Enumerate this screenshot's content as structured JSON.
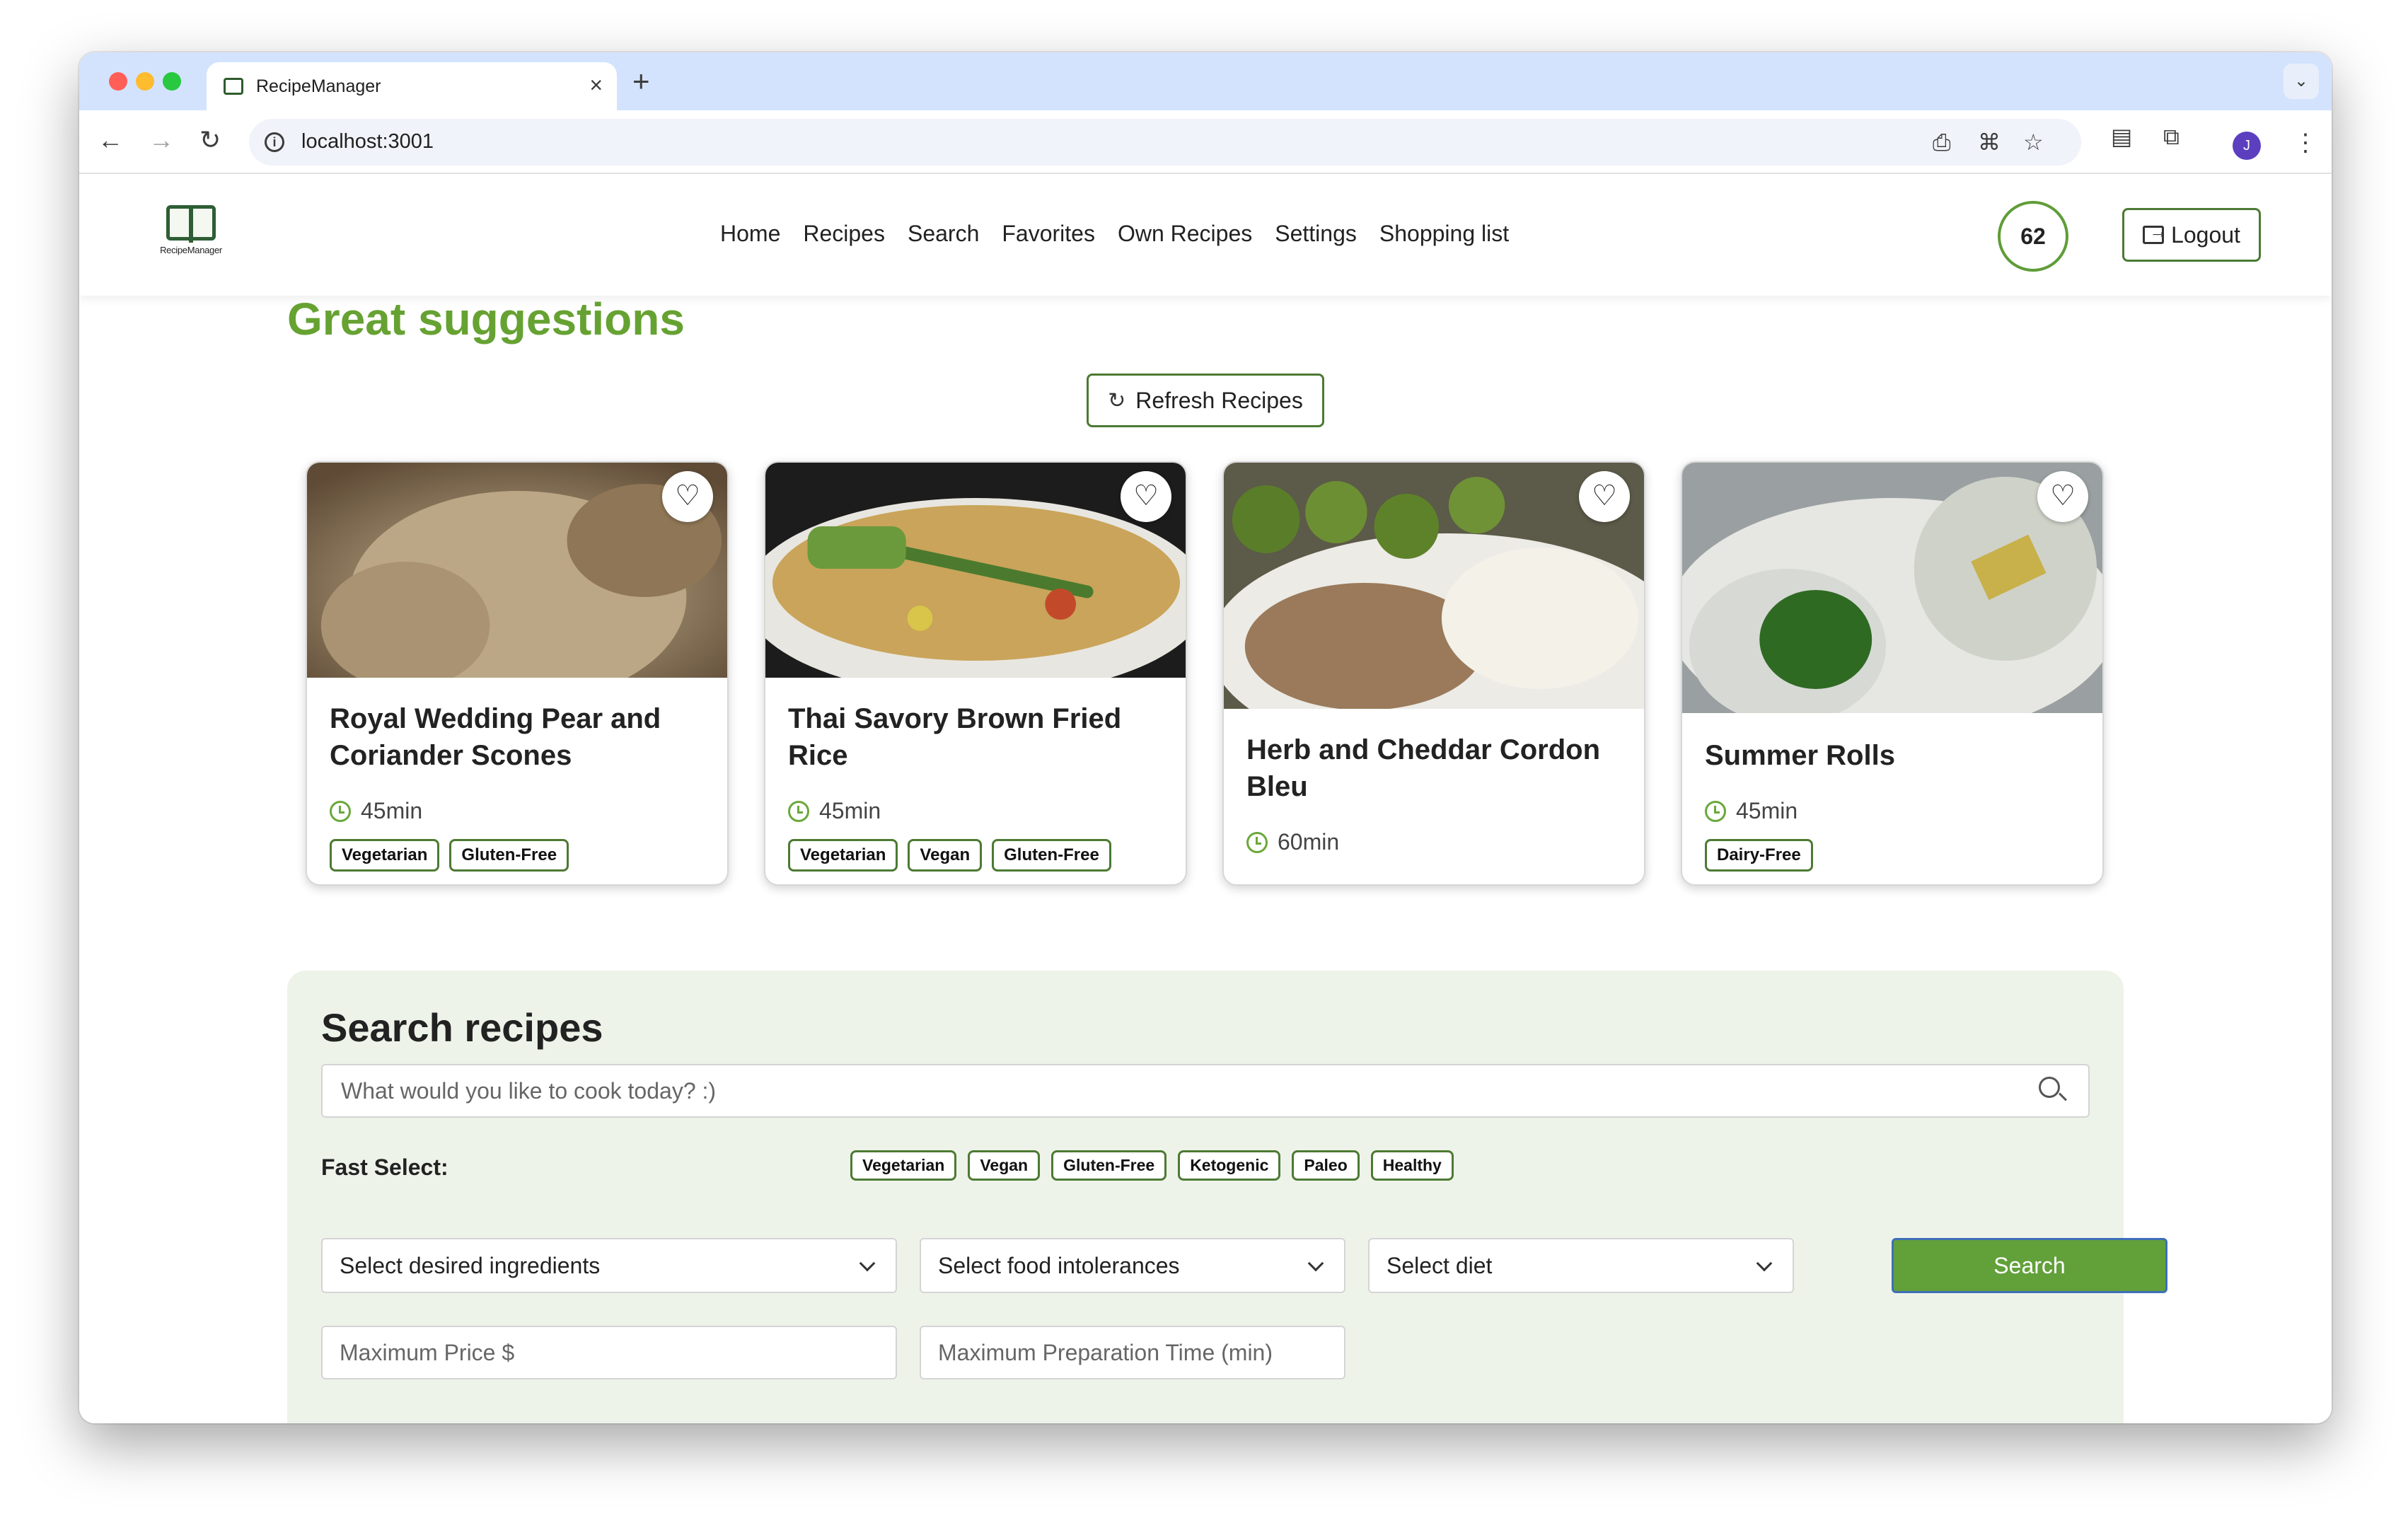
{
  "browser": {
    "tab_title": "RecipeManager",
    "url": "localhost:3001",
    "profile_initial": "J"
  },
  "app": {
    "logo_text": "RecipeManager",
    "nav": [
      "Home",
      "Recipes",
      "Search",
      "Favorites",
      "Own Recipes",
      "Settings",
      "Shopping list"
    ],
    "points": "62",
    "logout_label": "Logout"
  },
  "suggestions": {
    "title": "Great suggestions",
    "refresh_label": "Refresh Recipes",
    "cards": [
      {
        "title": "Royal Wedding Pear and Coriander Scones",
        "time": "45min",
        "tags": [
          "Vegetarian",
          "Gluten-Free"
        ],
        "image": "scones-photo"
      },
      {
        "title": "Thai Savory Brown Fried Rice",
        "time": "45min",
        "tags": [
          "Vegetarian",
          "Vegan",
          "Gluten-Free"
        ],
        "image": "fried-rice-photo"
      },
      {
        "title": "Herb and Cheddar Cordon Bleu",
        "time": "60min",
        "tags": [],
        "image": "cordon-bleu-photo"
      },
      {
        "title": "Summer Rolls",
        "time": "45min",
        "tags": [
          "Dairy-Free"
        ],
        "image": "summer-rolls-photo"
      }
    ]
  },
  "search": {
    "title": "Search recipes",
    "placeholder": "What would you like to cook today? :)",
    "fast_select_label": "Fast Select:",
    "fast_tags": [
      "Vegetarian",
      "Vegan",
      "Gluten-Free",
      "Ketogenic",
      "Paleo",
      "Healthy"
    ],
    "ingredients_placeholder": "Select desired ingredients",
    "intolerances_placeholder": "Select food intolerances",
    "diet_placeholder": "Select diet",
    "submit_label": "Search",
    "max_price_placeholder": "Maximum Price $",
    "max_time_placeholder": "Maximum Preparation Time (min)"
  },
  "colors": {
    "accent_green": "#66a232",
    "button_green": "#62a03a",
    "panel_bg": "#eef3ea"
  }
}
